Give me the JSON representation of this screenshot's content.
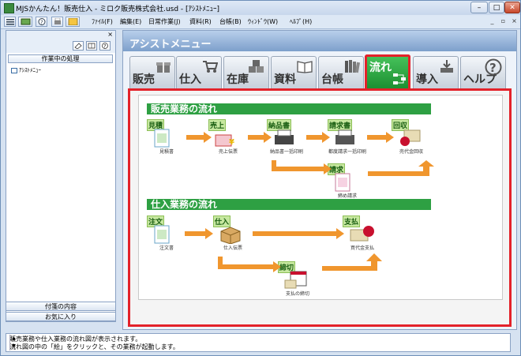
{
  "window": {
    "title": "MJSかんたん！販売仕入 - ミロク販売株式会社.usd - [ｱｼｽﾄﾒﾆｭｰ]"
  },
  "menubar": {
    "items": [
      "ﾌｧｲﾙ(F)",
      "編集(E)",
      "日常作業(J)",
      "資料(R)",
      "台帳(B)",
      "ｳｨﾝﾄﾞｳ(W)",
      "ﾍﾙﾌﾟ(H)"
    ]
  },
  "left_pane": {
    "header": "作業中の処理",
    "items": [
      {
        "label": "ｱｼｽﾄﾒﾆｭｰ"
      }
    ],
    "footer_buttons": [
      "付箋の内容",
      "お気に入り"
    ]
  },
  "main": {
    "header": "アシストメニュー",
    "tabs": [
      {
        "label": "販売",
        "icon": "gift-icon",
        "active": false
      },
      {
        "label": "仕入",
        "icon": "cart-icon",
        "active": false
      },
      {
        "label": "在庫",
        "icon": "boxes-icon",
        "active": false
      },
      {
        "label": "資料",
        "icon": "book-icon",
        "active": false
      },
      {
        "label": "台帳",
        "icon": "ledger-books-icon",
        "active": false
      },
      {
        "label": "流れ",
        "icon": "flow-icon",
        "active": true
      },
      {
        "label": "導入",
        "icon": "install-icon",
        "active": false
      },
      {
        "label": "ヘルプ",
        "icon": "help-icon",
        "active": false
      }
    ],
    "sales_flow": {
      "title": "販売業務の流れ",
      "nodes": [
        {
          "badge": "見積",
          "caption": "見積書"
        },
        {
          "badge": "売上",
          "caption": "売上伝票"
        },
        {
          "badge": "納品書",
          "caption": "納品書一括印刷"
        },
        {
          "badge": "請求書",
          "caption": "都度請求一括印刷"
        },
        {
          "badge": "回収",
          "caption": "売代金回収"
        },
        {
          "badge": "請求",
          "caption": "締め請求"
        }
      ]
    },
    "purchase_flow": {
      "title": "仕入業務の流れ",
      "nodes": [
        {
          "badge": "注文",
          "caption": "注文書"
        },
        {
          "badge": "仕入",
          "caption": "仕入伝票"
        },
        {
          "badge": "支払",
          "caption": "買代金支払"
        },
        {
          "badge": "締切",
          "caption": "支払の締切"
        }
      ]
    }
  },
  "status": {
    "line1": "販売業務や仕入業務の流れ図が表示されます。",
    "line2": "流れ図の中の「絵」をクリックと、その業務が起動します。"
  },
  "colors": {
    "accent_green": "#2ea043",
    "highlight_red": "#e3222a",
    "arrow_orange": "#f0962e"
  }
}
